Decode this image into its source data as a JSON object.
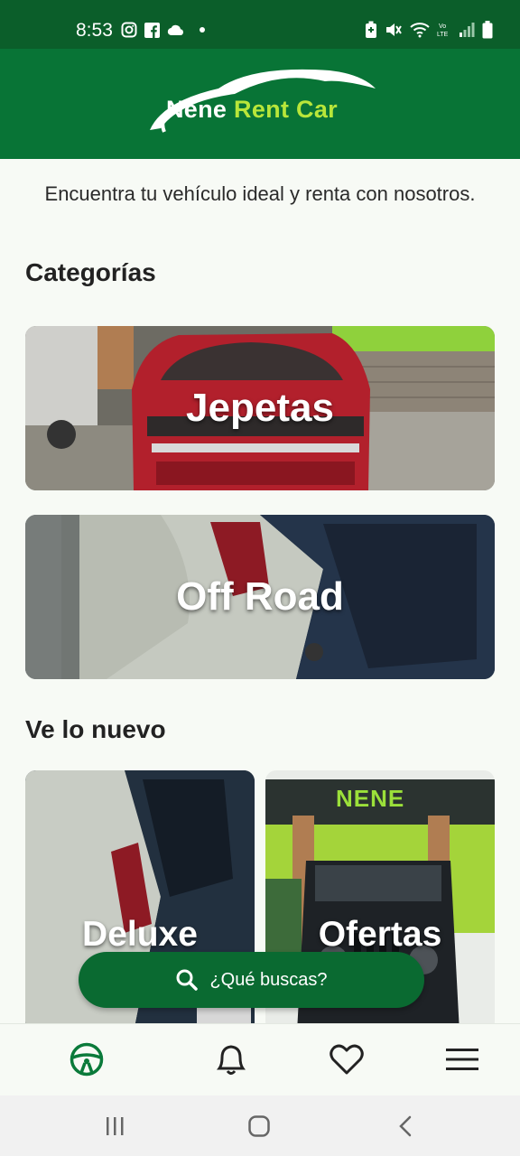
{
  "status_bar": {
    "time": "8:53",
    "left_icons": [
      "instagram-icon",
      "facebook-icon",
      "cloud-icon",
      "dot-icon"
    ],
    "right_icons": [
      "data-saver-icon",
      "mute-icon",
      "wifi-icon",
      "volte-icon",
      "signal-icon",
      "battery-icon"
    ]
  },
  "header": {
    "logo_text_part1": "Nene",
    "logo_text_part2": "Rent Car"
  },
  "intro_text": "Encuentra tu vehículo ideal y renta con nosotros.",
  "categories": {
    "title": "Categorías",
    "items": [
      {
        "label": "Jepetas"
      },
      {
        "label": "Off Road"
      }
    ]
  },
  "new_section": {
    "title": "Ve lo nuevo",
    "items": [
      {
        "label": "Deluxe"
      },
      {
        "label": "Ofertas",
        "sign_text": "NENE"
      }
    ]
  },
  "search": {
    "label": "¿Qué buscas?"
  },
  "bottom_nav": [
    "steering-wheel-icon",
    "bell-icon",
    "heart-icon",
    "menu-icon"
  ],
  "colors": {
    "brand_dark": "#0b5e2a",
    "brand": "#087436",
    "accent_lime": "#b8e63a",
    "background": "#f7faf5"
  }
}
